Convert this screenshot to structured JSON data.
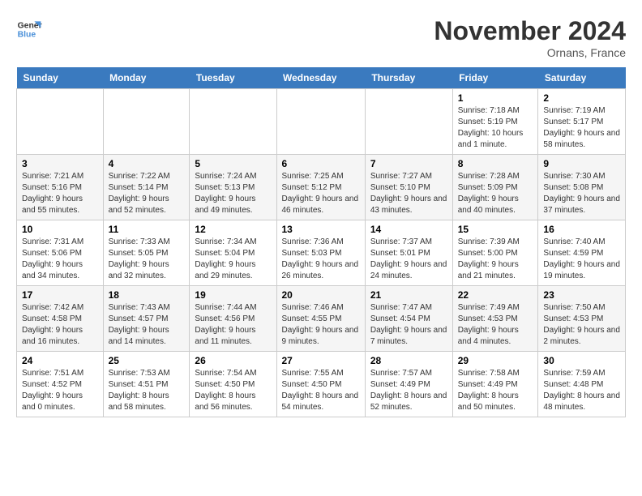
{
  "logo": {
    "line1": "General",
    "line2": "Blue"
  },
  "title": "November 2024",
  "location": "Ornans, France",
  "headers": [
    "Sunday",
    "Monday",
    "Tuesday",
    "Wednesday",
    "Thursday",
    "Friday",
    "Saturday"
  ],
  "weeks": [
    [
      {
        "day": "",
        "info": ""
      },
      {
        "day": "",
        "info": ""
      },
      {
        "day": "",
        "info": ""
      },
      {
        "day": "",
        "info": ""
      },
      {
        "day": "",
        "info": ""
      },
      {
        "day": "1",
        "info": "Sunrise: 7:18 AM\nSunset: 5:19 PM\nDaylight: 10 hours and 1 minute."
      },
      {
        "day": "2",
        "info": "Sunrise: 7:19 AM\nSunset: 5:17 PM\nDaylight: 9 hours and 58 minutes."
      }
    ],
    [
      {
        "day": "3",
        "info": "Sunrise: 7:21 AM\nSunset: 5:16 PM\nDaylight: 9 hours and 55 minutes."
      },
      {
        "day": "4",
        "info": "Sunrise: 7:22 AM\nSunset: 5:14 PM\nDaylight: 9 hours and 52 minutes."
      },
      {
        "day": "5",
        "info": "Sunrise: 7:24 AM\nSunset: 5:13 PM\nDaylight: 9 hours and 49 minutes."
      },
      {
        "day": "6",
        "info": "Sunrise: 7:25 AM\nSunset: 5:12 PM\nDaylight: 9 hours and 46 minutes."
      },
      {
        "day": "7",
        "info": "Sunrise: 7:27 AM\nSunset: 5:10 PM\nDaylight: 9 hours and 43 minutes."
      },
      {
        "day": "8",
        "info": "Sunrise: 7:28 AM\nSunset: 5:09 PM\nDaylight: 9 hours and 40 minutes."
      },
      {
        "day": "9",
        "info": "Sunrise: 7:30 AM\nSunset: 5:08 PM\nDaylight: 9 hours and 37 minutes."
      }
    ],
    [
      {
        "day": "10",
        "info": "Sunrise: 7:31 AM\nSunset: 5:06 PM\nDaylight: 9 hours and 34 minutes."
      },
      {
        "day": "11",
        "info": "Sunrise: 7:33 AM\nSunset: 5:05 PM\nDaylight: 9 hours and 32 minutes."
      },
      {
        "day": "12",
        "info": "Sunrise: 7:34 AM\nSunset: 5:04 PM\nDaylight: 9 hours and 29 minutes."
      },
      {
        "day": "13",
        "info": "Sunrise: 7:36 AM\nSunset: 5:03 PM\nDaylight: 9 hours and 26 minutes."
      },
      {
        "day": "14",
        "info": "Sunrise: 7:37 AM\nSunset: 5:01 PM\nDaylight: 9 hours and 24 minutes."
      },
      {
        "day": "15",
        "info": "Sunrise: 7:39 AM\nSunset: 5:00 PM\nDaylight: 9 hours and 21 minutes."
      },
      {
        "day": "16",
        "info": "Sunrise: 7:40 AM\nSunset: 4:59 PM\nDaylight: 9 hours and 19 minutes."
      }
    ],
    [
      {
        "day": "17",
        "info": "Sunrise: 7:42 AM\nSunset: 4:58 PM\nDaylight: 9 hours and 16 minutes."
      },
      {
        "day": "18",
        "info": "Sunrise: 7:43 AM\nSunset: 4:57 PM\nDaylight: 9 hours and 14 minutes."
      },
      {
        "day": "19",
        "info": "Sunrise: 7:44 AM\nSunset: 4:56 PM\nDaylight: 9 hours and 11 minutes."
      },
      {
        "day": "20",
        "info": "Sunrise: 7:46 AM\nSunset: 4:55 PM\nDaylight: 9 hours and 9 minutes."
      },
      {
        "day": "21",
        "info": "Sunrise: 7:47 AM\nSunset: 4:54 PM\nDaylight: 9 hours and 7 minutes."
      },
      {
        "day": "22",
        "info": "Sunrise: 7:49 AM\nSunset: 4:53 PM\nDaylight: 9 hours and 4 minutes."
      },
      {
        "day": "23",
        "info": "Sunrise: 7:50 AM\nSunset: 4:53 PM\nDaylight: 9 hours and 2 minutes."
      }
    ],
    [
      {
        "day": "24",
        "info": "Sunrise: 7:51 AM\nSunset: 4:52 PM\nDaylight: 9 hours and 0 minutes."
      },
      {
        "day": "25",
        "info": "Sunrise: 7:53 AM\nSunset: 4:51 PM\nDaylight: 8 hours and 58 minutes."
      },
      {
        "day": "26",
        "info": "Sunrise: 7:54 AM\nSunset: 4:50 PM\nDaylight: 8 hours and 56 minutes."
      },
      {
        "day": "27",
        "info": "Sunrise: 7:55 AM\nSunset: 4:50 PM\nDaylight: 8 hours and 54 minutes."
      },
      {
        "day": "28",
        "info": "Sunrise: 7:57 AM\nSunset: 4:49 PM\nDaylight: 8 hours and 52 minutes."
      },
      {
        "day": "29",
        "info": "Sunrise: 7:58 AM\nSunset: 4:49 PM\nDaylight: 8 hours and 50 minutes."
      },
      {
        "day": "30",
        "info": "Sunrise: 7:59 AM\nSunset: 4:48 PM\nDaylight: 8 hours and 48 minutes."
      }
    ]
  ]
}
